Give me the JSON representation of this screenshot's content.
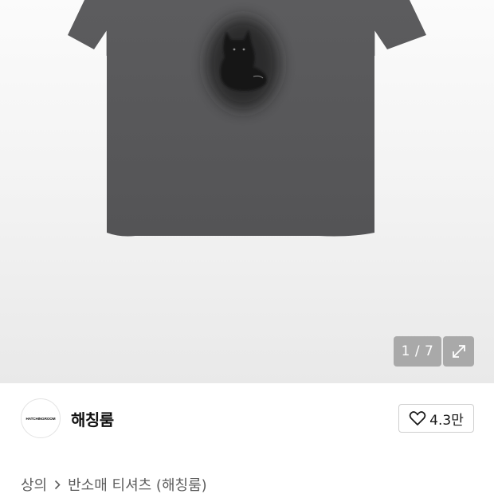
{
  "gallery": {
    "current_page": 1,
    "total_pages": 7,
    "counter_text": "1 / 7",
    "expand_icon": "expand-arrows-icon",
    "image_subject": "charcoal-tshirt-with-black-cat-print"
  },
  "brand": {
    "logo_text": "HATCHINGROOM",
    "name": "해칭룸"
  },
  "like": {
    "icon": "heart-outline-icon",
    "count": "4.3만"
  },
  "breadcrumb": {
    "category": "상의",
    "separator_icon": "chevron-right-icon",
    "subcategory": "반소매 티셔츠 (해칭룸)"
  },
  "colors": {
    "tshirt": "#58585a",
    "counter_bg": "#969696",
    "text_primary": "#111111",
    "text_secondary": "#5c5c5c"
  }
}
